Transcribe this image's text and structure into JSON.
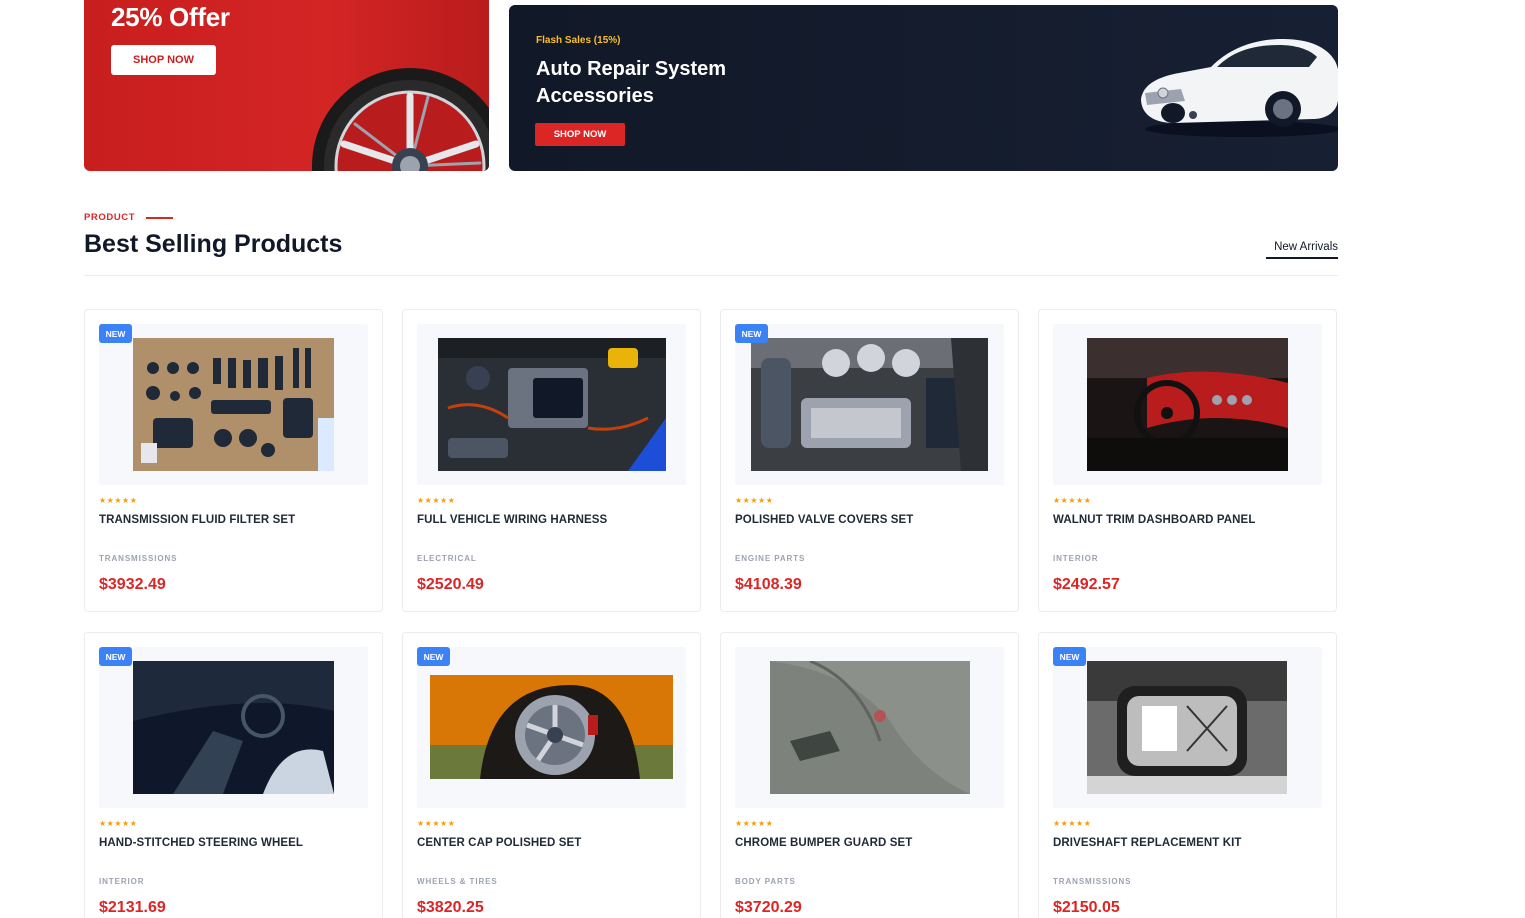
{
  "banners": {
    "offer": {
      "title": "25% Offer",
      "button": "SHOP NOW",
      "image_icon": "alloy-wheel-icon",
      "color": "#d42525"
    },
    "flash": {
      "kicker": "Flash Sales (15%)",
      "headline": "Auto Repair System Accessories",
      "button": "SHOP NOW",
      "image_icon": "white-coupe-car-icon",
      "color": "#111827"
    }
  },
  "section": {
    "kicker": "PRODUCT",
    "title": "Best Selling Products",
    "tab": "New Arrivals"
  },
  "colors": {
    "accent": "#dc2626",
    "badge": "#3b82f6",
    "stars": "#f59e0b"
  },
  "products": [
    {
      "name": "TRANSMISSION FLUID FILTER SET",
      "category": "TRANSMISSIONS",
      "price": "$3932.49",
      "badge": "NEW",
      "rating": "★★★★★",
      "image": "tool-wall-photo"
    },
    {
      "name": "FULL VEHICLE WIRING HARNESS",
      "category": "ELECTRICAL",
      "price": "$2520.49",
      "badge": "",
      "rating": "★★★★★",
      "image": "engine-bay-photo"
    },
    {
      "name": "POLISHED VALVE COVERS SET",
      "category": "ENGINE PARTS",
      "price": "$4108.39",
      "badge": "NEW",
      "rating": "★★★★★",
      "image": "chrome-engine-photo"
    },
    {
      "name": "WALNUT TRIM DASHBOARD PANEL",
      "category": "INTERIOR",
      "price": "$2492.57",
      "badge": "",
      "rating": "★★★★★",
      "image": "red-dashboard-photo"
    },
    {
      "name": "HAND-STITCHED STEERING WHEEL",
      "category": "INTERIOR",
      "price": "$2131.69",
      "badge": "NEW",
      "rating": "★★★★★",
      "image": "dark-interior-photo"
    },
    {
      "name": "CENTER CAP POLISHED SET",
      "category": "WHEELS & TIRES",
      "price": "$3820.25",
      "badge": "NEW",
      "rating": "★★★★★",
      "image": "orange-car-wheel-photo"
    },
    {
      "name": "CHROME BUMPER GUARD SET",
      "category": "BODY PARTS",
      "price": "$3720.29",
      "badge": "",
      "rating": "★★★★★",
      "image": "grey-car-body-photo"
    },
    {
      "name": "DRIVESHAFT REPLACEMENT KIT",
      "category": "TRANSMISSIONS",
      "price": "$2150.05",
      "badge": "NEW",
      "rating": "★★★★★",
      "image": "vintage-radio-photo"
    }
  ]
}
